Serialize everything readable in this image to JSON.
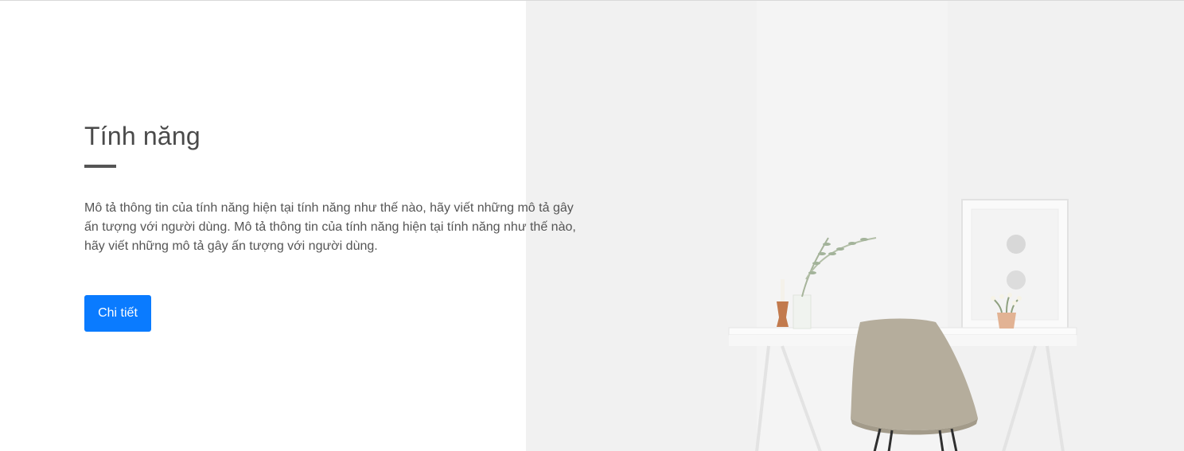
{
  "feature": {
    "title": "Tính năng",
    "description": "Mô tả thông tin của tính năng hiện tại tính năng như thế nào, hãy viết những mô tả gây ấn tượng với người dùng. Mô tả thông tin của tính năng hiện tại tính năng như thế nào, hãy viết những mô tả gây ấn tượng với người dùng.",
    "button_label": "Chi tiết"
  },
  "colors": {
    "accent": "#0a7bff",
    "title": "#4a4a4a",
    "text": "#555555",
    "chair": "#b5ad9c"
  },
  "hero": {
    "image": "photo of a white desk with a beige chair, a framed print, a vase with plants and a candle against a white wall"
  }
}
